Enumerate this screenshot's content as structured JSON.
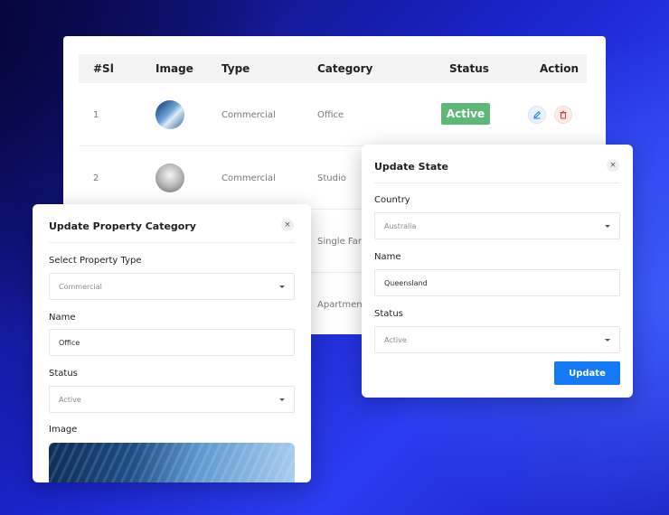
{
  "table": {
    "headers": [
      "#Sl",
      "Image",
      "Type",
      "Category",
      "Status",
      "Action"
    ],
    "rows": [
      {
        "sl": "1",
        "image": "office-building-thumbnail",
        "type": "Commercial",
        "category": "Office",
        "status": "Active"
      },
      {
        "sl": "2",
        "image": "studio-building-thumbnail",
        "type": "Commercial",
        "category": "Studio",
        "status": ""
      },
      {
        "sl": "",
        "image": "",
        "type": "",
        "category": "Single Fan",
        "status": ""
      },
      {
        "sl": "",
        "image": "",
        "type": "",
        "category": "Apartmen",
        "status": ""
      }
    ],
    "status_color": "#5fb878",
    "icons": {
      "edit": "edit-icon",
      "delete": "trash-icon"
    }
  },
  "update_category_modal": {
    "title": "Update Property Category",
    "close": "×",
    "property_type_label": "Select Property Type",
    "property_type_value": "Commercial",
    "name_label": "Name",
    "name_value": "Office",
    "status_label": "Status",
    "status_value": "Active",
    "image_label": "Image"
  },
  "update_state_modal": {
    "title": "Update State",
    "close": "×",
    "country_label": "Country",
    "country_value": "Australia",
    "name_label": "Name",
    "name_value": "Queensland",
    "status_label": "Status",
    "status_value": "Active",
    "update_button": "Update",
    "button_color": "#1479f5"
  }
}
